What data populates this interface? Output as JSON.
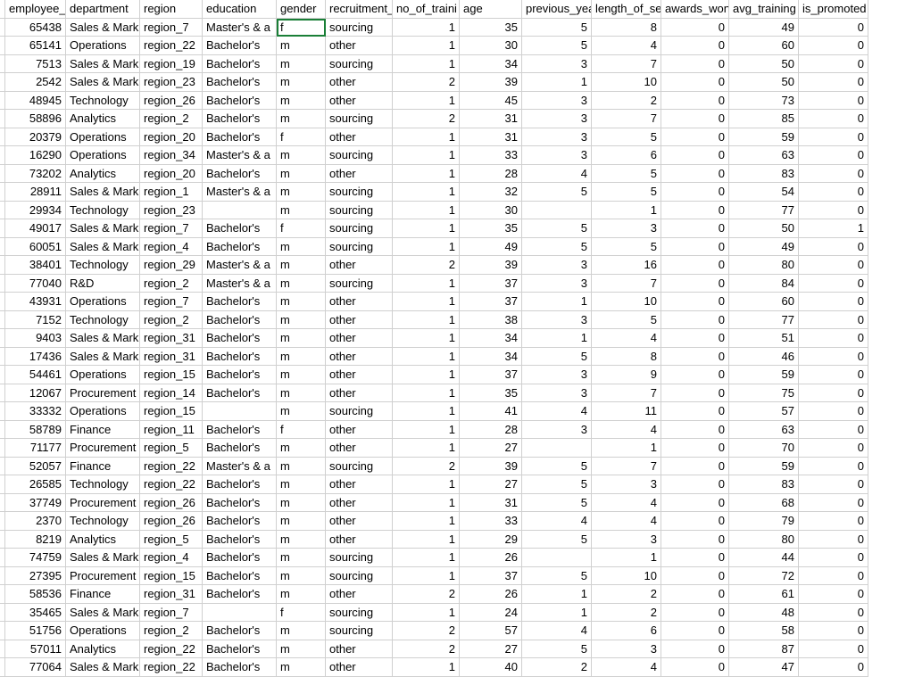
{
  "columns": [
    "employee_id",
    "department",
    "region",
    "education",
    "gender",
    "recruitment_",
    "no_of_traini",
    "age",
    "previous_yea",
    "length_of_se",
    "awards_won",
    "avg_training",
    "is_promoted"
  ],
  "selected_cell": {
    "row": 0,
    "col": 4
  },
  "rows": [
    {
      "employee_id": 65438,
      "department": "Sales & Mark",
      "region": "region_7",
      "education": "Master's & a",
      "gender": "f",
      "recruitment": "sourcing",
      "no_of_training": 1,
      "age": 35,
      "previous_year": 5,
      "length_of_service": 8,
      "awards_won": 0,
      "avg_training": 49,
      "is_promoted": 0
    },
    {
      "employee_id": 65141,
      "department": "Operations",
      "region": "region_22",
      "education": "Bachelor's",
      "gender": "m",
      "recruitment": "other",
      "no_of_training": 1,
      "age": 30,
      "previous_year": 5,
      "length_of_service": 4,
      "awards_won": 0,
      "avg_training": 60,
      "is_promoted": 0
    },
    {
      "employee_id": 7513,
      "department": "Sales & Mark",
      "region": "region_19",
      "education": "Bachelor's",
      "gender": "m",
      "recruitment": "sourcing",
      "no_of_training": 1,
      "age": 34,
      "previous_year": 3,
      "length_of_service": 7,
      "awards_won": 0,
      "avg_training": 50,
      "is_promoted": 0
    },
    {
      "employee_id": 2542,
      "department": "Sales & Mark",
      "region": "region_23",
      "education": "Bachelor's",
      "gender": "m",
      "recruitment": "other",
      "no_of_training": 2,
      "age": 39,
      "previous_year": 1,
      "length_of_service": 10,
      "awards_won": 0,
      "avg_training": 50,
      "is_promoted": 0
    },
    {
      "employee_id": 48945,
      "department": "Technology",
      "region": "region_26",
      "education": "Bachelor's",
      "gender": "m",
      "recruitment": "other",
      "no_of_training": 1,
      "age": 45,
      "previous_year": 3,
      "length_of_service": 2,
      "awards_won": 0,
      "avg_training": 73,
      "is_promoted": 0
    },
    {
      "employee_id": 58896,
      "department": "Analytics",
      "region": "region_2",
      "education": "Bachelor's",
      "gender": "m",
      "recruitment": "sourcing",
      "no_of_training": 2,
      "age": 31,
      "previous_year": 3,
      "length_of_service": 7,
      "awards_won": 0,
      "avg_training": 85,
      "is_promoted": 0
    },
    {
      "employee_id": 20379,
      "department": "Operations",
      "region": "region_20",
      "education": "Bachelor's",
      "gender": "f",
      "recruitment": "other",
      "no_of_training": 1,
      "age": 31,
      "previous_year": 3,
      "length_of_service": 5,
      "awards_won": 0,
      "avg_training": 59,
      "is_promoted": 0
    },
    {
      "employee_id": 16290,
      "department": "Operations",
      "region": "region_34",
      "education": "Master's & a",
      "gender": "m",
      "recruitment": "sourcing",
      "no_of_training": 1,
      "age": 33,
      "previous_year": 3,
      "length_of_service": 6,
      "awards_won": 0,
      "avg_training": 63,
      "is_promoted": 0
    },
    {
      "employee_id": 73202,
      "department": "Analytics",
      "region": "region_20",
      "education": "Bachelor's",
      "gender": "m",
      "recruitment": "other",
      "no_of_training": 1,
      "age": 28,
      "previous_year": 4,
      "length_of_service": 5,
      "awards_won": 0,
      "avg_training": 83,
      "is_promoted": 0
    },
    {
      "employee_id": 28911,
      "department": "Sales & Mark",
      "region": "region_1",
      "education": "Master's & a",
      "gender": "m",
      "recruitment": "sourcing",
      "no_of_training": 1,
      "age": 32,
      "previous_year": 5,
      "length_of_service": 5,
      "awards_won": 0,
      "avg_training": 54,
      "is_promoted": 0
    },
    {
      "employee_id": 29934,
      "department": "Technology",
      "region": "region_23",
      "education": "",
      "gender": "m",
      "recruitment": "sourcing",
      "no_of_training": 1,
      "age": 30,
      "previous_year": "",
      "length_of_service": 1,
      "awards_won": 0,
      "avg_training": 77,
      "is_promoted": 0
    },
    {
      "employee_id": 49017,
      "department": "Sales & Mark",
      "region": "region_7",
      "education": "Bachelor's",
      "gender": "f",
      "recruitment": "sourcing",
      "no_of_training": 1,
      "age": 35,
      "previous_year": 5,
      "length_of_service": 3,
      "awards_won": 0,
      "avg_training": 50,
      "is_promoted": 1
    },
    {
      "employee_id": 60051,
      "department": "Sales & Mark",
      "region": "region_4",
      "education": "Bachelor's",
      "gender": "m",
      "recruitment": "sourcing",
      "no_of_training": 1,
      "age": 49,
      "previous_year": 5,
      "length_of_service": 5,
      "awards_won": 0,
      "avg_training": 49,
      "is_promoted": 0
    },
    {
      "employee_id": 38401,
      "department": "Technology",
      "region": "region_29",
      "education": "Master's & a",
      "gender": "m",
      "recruitment": "other",
      "no_of_training": 2,
      "age": 39,
      "previous_year": 3,
      "length_of_service": 16,
      "awards_won": 0,
      "avg_training": 80,
      "is_promoted": 0
    },
    {
      "employee_id": 77040,
      "department": "R&D",
      "region": "region_2",
      "education": "Master's & a",
      "gender": "m",
      "recruitment": "sourcing",
      "no_of_training": 1,
      "age": 37,
      "previous_year": 3,
      "length_of_service": 7,
      "awards_won": 0,
      "avg_training": 84,
      "is_promoted": 0
    },
    {
      "employee_id": 43931,
      "department": "Operations",
      "region": "region_7",
      "education": "Bachelor's",
      "gender": "m",
      "recruitment": "other",
      "no_of_training": 1,
      "age": 37,
      "previous_year": 1,
      "length_of_service": 10,
      "awards_won": 0,
      "avg_training": 60,
      "is_promoted": 0
    },
    {
      "employee_id": 7152,
      "department": "Technology",
      "region": "region_2",
      "education": "Bachelor's",
      "gender": "m",
      "recruitment": "other",
      "no_of_training": 1,
      "age": 38,
      "previous_year": 3,
      "length_of_service": 5,
      "awards_won": 0,
      "avg_training": 77,
      "is_promoted": 0
    },
    {
      "employee_id": 9403,
      "department": "Sales & Mark",
      "region": "region_31",
      "education": "Bachelor's",
      "gender": "m",
      "recruitment": "other",
      "no_of_training": 1,
      "age": 34,
      "previous_year": 1,
      "length_of_service": 4,
      "awards_won": 0,
      "avg_training": 51,
      "is_promoted": 0
    },
    {
      "employee_id": 17436,
      "department": "Sales & Mark",
      "region": "region_31",
      "education": "Bachelor's",
      "gender": "m",
      "recruitment": "other",
      "no_of_training": 1,
      "age": 34,
      "previous_year": 5,
      "length_of_service": 8,
      "awards_won": 0,
      "avg_training": 46,
      "is_promoted": 0
    },
    {
      "employee_id": 54461,
      "department": "Operations",
      "region": "region_15",
      "education": "Bachelor's",
      "gender": "m",
      "recruitment": "other",
      "no_of_training": 1,
      "age": 37,
      "previous_year": 3,
      "length_of_service": 9,
      "awards_won": 0,
      "avg_training": 59,
      "is_promoted": 0
    },
    {
      "employee_id": 12067,
      "department": "Procurement",
      "region": "region_14",
      "education": "Bachelor's",
      "gender": "m",
      "recruitment": "other",
      "no_of_training": 1,
      "age": 35,
      "previous_year": 3,
      "length_of_service": 7,
      "awards_won": 0,
      "avg_training": 75,
      "is_promoted": 0
    },
    {
      "employee_id": 33332,
      "department": "Operations",
      "region": "region_15",
      "education": "",
      "gender": "m",
      "recruitment": "sourcing",
      "no_of_training": 1,
      "age": 41,
      "previous_year": 4,
      "length_of_service": 11,
      "awards_won": 0,
      "avg_training": 57,
      "is_promoted": 0
    },
    {
      "employee_id": 58789,
      "department": "Finance",
      "region": "region_11",
      "education": "Bachelor's",
      "gender": "f",
      "recruitment": "other",
      "no_of_training": 1,
      "age": 28,
      "previous_year": 3,
      "length_of_service": 4,
      "awards_won": 0,
      "avg_training": 63,
      "is_promoted": 0
    },
    {
      "employee_id": 71177,
      "department": "Procurement",
      "region": "region_5",
      "education": "Bachelor's",
      "gender": "m",
      "recruitment": "other",
      "no_of_training": 1,
      "age": 27,
      "previous_year": "",
      "length_of_service": 1,
      "awards_won": 0,
      "avg_training": 70,
      "is_promoted": 0
    },
    {
      "employee_id": 52057,
      "department": "Finance",
      "region": "region_22",
      "education": "Master's & a",
      "gender": "m",
      "recruitment": "sourcing",
      "no_of_training": 2,
      "age": 39,
      "previous_year": 5,
      "length_of_service": 7,
      "awards_won": 0,
      "avg_training": 59,
      "is_promoted": 0
    },
    {
      "employee_id": 26585,
      "department": "Technology",
      "region": "region_22",
      "education": "Bachelor's",
      "gender": "m",
      "recruitment": "other",
      "no_of_training": 1,
      "age": 27,
      "previous_year": 5,
      "length_of_service": 3,
      "awards_won": 0,
      "avg_training": 83,
      "is_promoted": 0
    },
    {
      "employee_id": 37749,
      "department": "Procurement",
      "region": "region_26",
      "education": "Bachelor's",
      "gender": "m",
      "recruitment": "other",
      "no_of_training": 1,
      "age": 31,
      "previous_year": 5,
      "length_of_service": 4,
      "awards_won": 0,
      "avg_training": 68,
      "is_promoted": 0
    },
    {
      "employee_id": 2370,
      "department": "Technology",
      "region": "region_26",
      "education": "Bachelor's",
      "gender": "m",
      "recruitment": "other",
      "no_of_training": 1,
      "age": 33,
      "previous_year": 4,
      "length_of_service": 4,
      "awards_won": 0,
      "avg_training": 79,
      "is_promoted": 0
    },
    {
      "employee_id": 8219,
      "department": "Analytics",
      "region": "region_5",
      "education": "Bachelor's",
      "gender": "m",
      "recruitment": "other",
      "no_of_training": 1,
      "age": 29,
      "previous_year": 5,
      "length_of_service": 3,
      "awards_won": 0,
      "avg_training": 80,
      "is_promoted": 0
    },
    {
      "employee_id": 74759,
      "department": "Sales & Mark",
      "region": "region_4",
      "education": "Bachelor's",
      "gender": "m",
      "recruitment": "sourcing",
      "no_of_training": 1,
      "age": 26,
      "previous_year": "",
      "length_of_service": 1,
      "awards_won": 0,
      "avg_training": 44,
      "is_promoted": 0
    },
    {
      "employee_id": 27395,
      "department": "Procurement",
      "region": "region_15",
      "education": "Bachelor's",
      "gender": "m",
      "recruitment": "sourcing",
      "no_of_training": 1,
      "age": 37,
      "previous_year": 5,
      "length_of_service": 10,
      "awards_won": 0,
      "avg_training": 72,
      "is_promoted": 0
    },
    {
      "employee_id": 58536,
      "department": "Finance",
      "region": "region_31",
      "education": "Bachelor's",
      "gender": "m",
      "recruitment": "other",
      "no_of_training": 2,
      "age": 26,
      "previous_year": 1,
      "length_of_service": 2,
      "awards_won": 0,
      "avg_training": 61,
      "is_promoted": 0
    },
    {
      "employee_id": 35465,
      "department": "Sales & Mark",
      "region": "region_7",
      "education": "",
      "gender": "f",
      "recruitment": "sourcing",
      "no_of_training": 1,
      "age": 24,
      "previous_year": 1,
      "length_of_service": 2,
      "awards_won": 0,
      "avg_training": 48,
      "is_promoted": 0
    },
    {
      "employee_id": 51756,
      "department": "Operations",
      "region": "region_2",
      "education": "Bachelor's",
      "gender": "m",
      "recruitment": "sourcing",
      "no_of_training": 2,
      "age": 57,
      "previous_year": 4,
      "length_of_service": 6,
      "awards_won": 0,
      "avg_training": 58,
      "is_promoted": 0
    },
    {
      "employee_id": 57011,
      "department": "Analytics",
      "region": "region_22",
      "education": "Bachelor's",
      "gender": "m",
      "recruitment": "other",
      "no_of_training": 2,
      "age": 27,
      "previous_year": 5,
      "length_of_service": 3,
      "awards_won": 0,
      "avg_training": 87,
      "is_promoted": 0
    },
    {
      "employee_id": 77064,
      "department": "Sales & Mark",
      "region": "region_22",
      "education": "Bachelor's",
      "gender": "m",
      "recruitment": "other",
      "no_of_training": 1,
      "age": 40,
      "previous_year": 2,
      "length_of_service": 4,
      "awards_won": 0,
      "avg_training": 47,
      "is_promoted": 0
    }
  ]
}
